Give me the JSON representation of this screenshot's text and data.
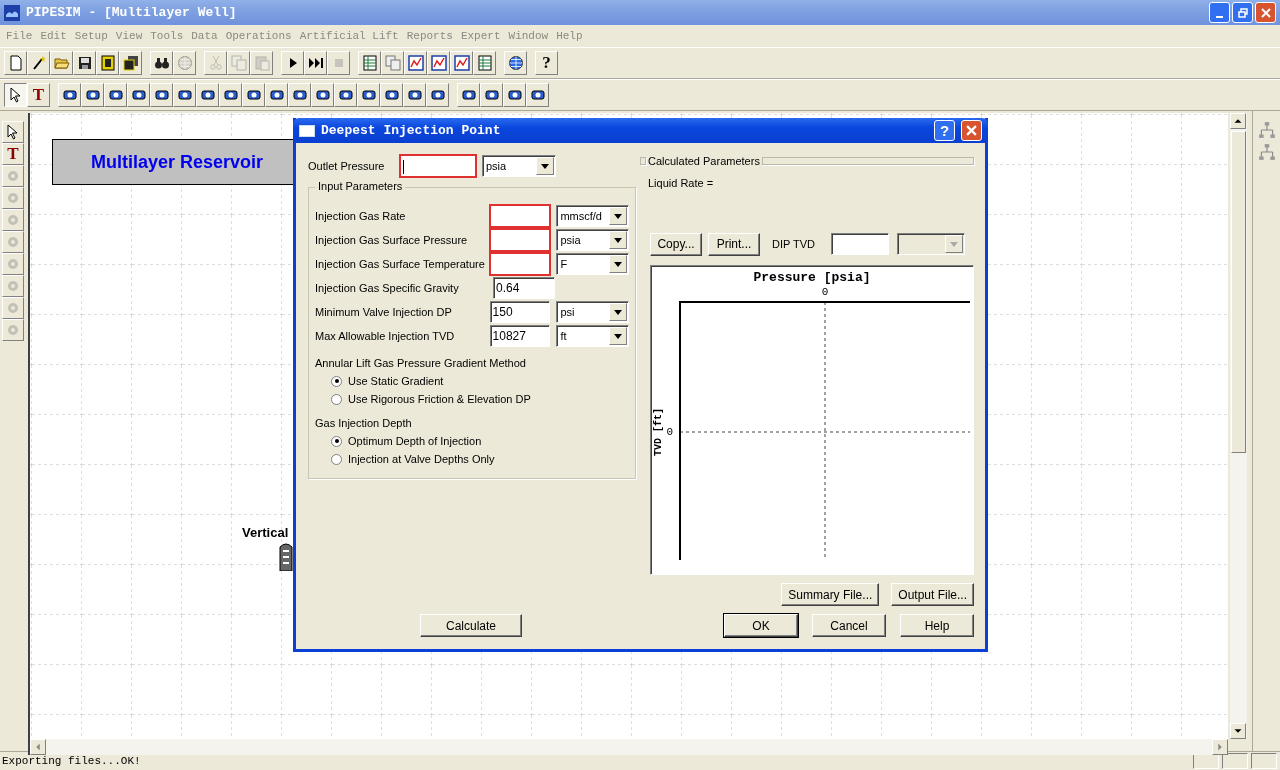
{
  "window": {
    "title": "PIPESIM - [Multilayer Well]"
  },
  "menu": [
    {
      "label": "File"
    },
    {
      "label": "Edit"
    },
    {
      "label": "Setup"
    },
    {
      "label": "View"
    },
    {
      "label": "Tools"
    },
    {
      "label": "Data"
    },
    {
      "label": "Operations"
    },
    {
      "label": "Artificial Lift"
    },
    {
      "label": "Reports"
    },
    {
      "label": "Expert"
    },
    {
      "label": "Window"
    },
    {
      "label": "Help"
    }
  ],
  "toolbar_1": [
    {
      "kind": "doc",
      "disabled": false
    },
    {
      "kind": "wand",
      "disabled": false
    },
    {
      "kind": "folder",
      "disabled": false
    },
    {
      "kind": "disk",
      "disabled": false
    },
    {
      "kind": "note",
      "disabled": false
    },
    {
      "kind": "disks",
      "disabled": false
    },
    {
      "kind": "sep"
    },
    {
      "kind": "find",
      "disabled": false
    },
    {
      "kind": "grid",
      "disabled": true
    },
    {
      "kind": "sep"
    },
    {
      "kind": "cut",
      "disabled": true
    },
    {
      "kind": "copy",
      "disabled": true
    },
    {
      "kind": "paste",
      "disabled": true
    },
    {
      "kind": "sep"
    },
    {
      "kind": "play",
      "disabled": false
    },
    {
      "kind": "skip",
      "disabled": false
    },
    {
      "kind": "stop",
      "disabled": true
    },
    {
      "kind": "sep"
    },
    {
      "kind": "table",
      "disabled": false
    },
    {
      "kind": "copy",
      "disabled": false
    },
    {
      "kind": "chart",
      "disabled": false
    },
    {
      "kind": "chart",
      "disabled": false
    },
    {
      "kind": "chart",
      "disabled": false
    },
    {
      "kind": "table",
      "disabled": false
    },
    {
      "kind": "sep"
    },
    {
      "kind": "globe",
      "disabled": false
    },
    {
      "kind": "sep"
    },
    {
      "kind": "help",
      "glyph": "?",
      "disabled": false
    }
  ],
  "toolbar_2": [
    {
      "kind": "cursor",
      "selected": true
    },
    {
      "kind": "text",
      "glyph": "T",
      "selected": false
    },
    {
      "kind": "sep"
    },
    {
      "kind": "device",
      "selected": false
    },
    {
      "kind": "device",
      "selected": false
    },
    {
      "kind": "device",
      "selected": false
    },
    {
      "kind": "device",
      "selected": false
    },
    {
      "kind": "device",
      "selected": false
    },
    {
      "kind": "device",
      "selected": false
    },
    {
      "kind": "device",
      "selected": false
    },
    {
      "kind": "device",
      "selected": false
    },
    {
      "kind": "device",
      "selected": false
    },
    {
      "kind": "device",
      "selected": false
    },
    {
      "kind": "device",
      "selected": false
    },
    {
      "kind": "device",
      "selected": false
    },
    {
      "kind": "device",
      "selected": false
    },
    {
      "kind": "device",
      "selected": false
    },
    {
      "kind": "device",
      "selected": false
    },
    {
      "kind": "device",
      "selected": false
    },
    {
      "kind": "device",
      "selected": false
    },
    {
      "kind": "sep"
    },
    {
      "kind": "device",
      "selected": false
    },
    {
      "kind": "device",
      "selected": false
    },
    {
      "kind": "device",
      "selected": false
    },
    {
      "kind": "device",
      "selected": false
    }
  ],
  "side_tools": [
    {
      "kind": "cursor",
      "disabled": false
    },
    {
      "kind": "text",
      "glyph": "T",
      "disabled": false
    },
    {
      "kind": "device",
      "disabled": true
    },
    {
      "kind": "device",
      "disabled": true
    },
    {
      "kind": "device",
      "disabled": true
    },
    {
      "kind": "device",
      "disabled": true
    },
    {
      "kind": "device",
      "disabled": true
    },
    {
      "kind": "device",
      "disabled": true
    },
    {
      "kind": "device",
      "disabled": true
    },
    {
      "kind": "device",
      "disabled": true
    }
  ],
  "canvas": {
    "reservoir_label": "Multilayer Reservoir",
    "well_label": "Vertical"
  },
  "dialog": {
    "title": "Deepest Injection Point",
    "help_glyph": "?",
    "outlet_pressure": {
      "label": "Outlet Pressure",
      "required": true,
      "unit": "psia"
    },
    "input_parameters": {
      "title": "Input Parameters",
      "fields": [
        {
          "label": "Injection Gas Rate",
          "required": true,
          "unit": "mmscf/d"
        },
        {
          "label": "Injection Gas Surface Pressure",
          "required": true,
          "unit": "psia"
        },
        {
          "label": "Injection Gas Surface Temperature",
          "required": true,
          "unit": "F"
        },
        {
          "label": "Injection Gas Specific Gravity",
          "required": false,
          "value": "0.64"
        },
        {
          "label": "Minimum Valve Injection DP",
          "required": false,
          "value": "150",
          "unit": "psi"
        },
        {
          "label": "Max Allowable Injection TVD",
          "required": false,
          "value": "10827",
          "unit": "ft"
        }
      ],
      "groups": [
        {
          "title": "Annular Lift Gas Pressure Gradient Method",
          "options": [
            {
              "label": "Use Static Gradient",
              "selected": true
            },
            {
              "label": "Use Rigorous Friction & Elevation DP",
              "selected": false
            }
          ]
        },
        {
          "title": "Gas Injection Depth",
          "options": [
            {
              "label": "Optimum Depth of Injection",
              "selected": true
            },
            {
              "label": "Injection at Valve Depths Only",
              "selected": false
            }
          ]
        }
      ]
    },
    "calculated": {
      "title": "Calculated Parameters",
      "liquid_rate": "Liquid Rate ="
    },
    "copy_button": "Copy...",
    "print_button": "Print...",
    "dip_tvd": {
      "label": "DIP TVD"
    },
    "plot": {
      "title": "Pressure [psia]",
      "ylabel": "TVD [ft]",
      "x_tick": "0",
      "y_tick": "0"
    },
    "summary_button": "Summary File...",
    "output_button": "Output File...",
    "calculate_button": "Calculate",
    "ok_button": {
      "label": "OK",
      "default": true
    },
    "cancel_button": "Cancel",
    "help_button": "Help"
  },
  "status_bar": {
    "text": "Exporting files...OK!"
  }
}
